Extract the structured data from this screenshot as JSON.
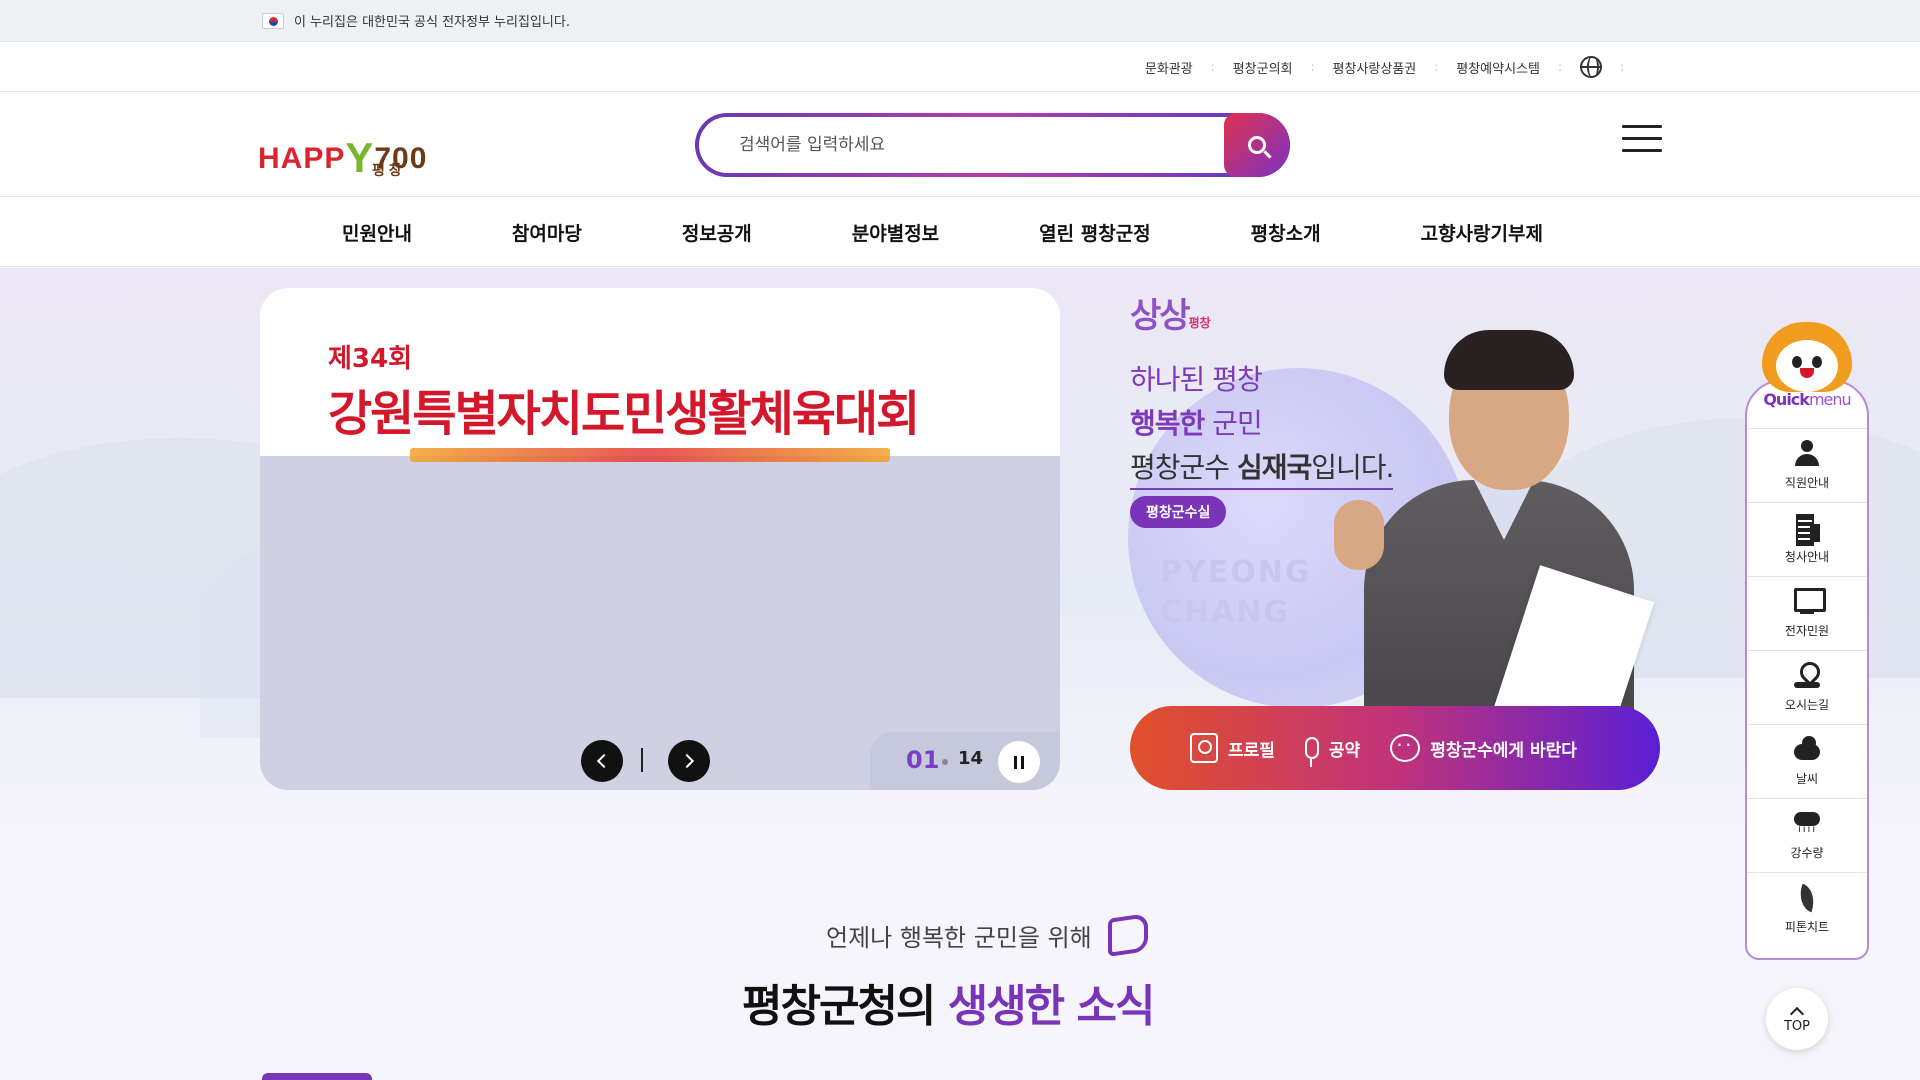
{
  "gov_banner": {
    "text": "이 누리집은 대한민국 공식 전자정부 누리집입니다."
  },
  "utility_links": [
    "문화관광",
    "평창군의회",
    "평창사랑상품권",
    "평창예약시스템"
  ],
  "logo": {
    "text_h": "HAPP",
    "text_y": "Y",
    "text_n": "700",
    "sub": "평창"
  },
  "search": {
    "placeholder": "검색어를 입력하세요"
  },
  "gnb": [
    "민원안내",
    "참여마당",
    "정보공개",
    "분야별정보",
    "열린 평창군정",
    "평창소개",
    "고향사랑기부제"
  ],
  "banner": {
    "kicker": "제34회",
    "title": "강원특별자치도민생활체육대회",
    "current": "01",
    "total": "14"
  },
  "governor": {
    "brand": "상상",
    "brand_small": "평창",
    "line1": "하나된 평창",
    "line2_bold": "행복한",
    "line2_rest": " 군민",
    "line3_a": "평창군수 ",
    "line3_bold": "심재국",
    "line3_b": "입니다.",
    "badge": "평창군수실",
    "watermark_1": "PYEONG",
    "watermark_2": "CHANG",
    "actions": [
      "프로필",
      "공약",
      "평창군수에게 바란다"
    ]
  },
  "news": {
    "kicker": "언제나 행복한 군민을 위해",
    "title_a": "평창군청의 ",
    "title_hl": "생생한 소식"
  },
  "quickmenu": {
    "title_a": "Quick",
    "title_b": "menu",
    "items": [
      "직원안내",
      "청사안내",
      "전자민원",
      "오시는길",
      "날씨",
      "강수량",
      "피톤치트"
    ]
  },
  "top_button": "TOP",
  "colors": {
    "accent": "#7a34b8",
    "brand_red": "#d3182c",
    "gradient_start": "#e2502a",
    "gradient_end": "#5a1fd4"
  }
}
